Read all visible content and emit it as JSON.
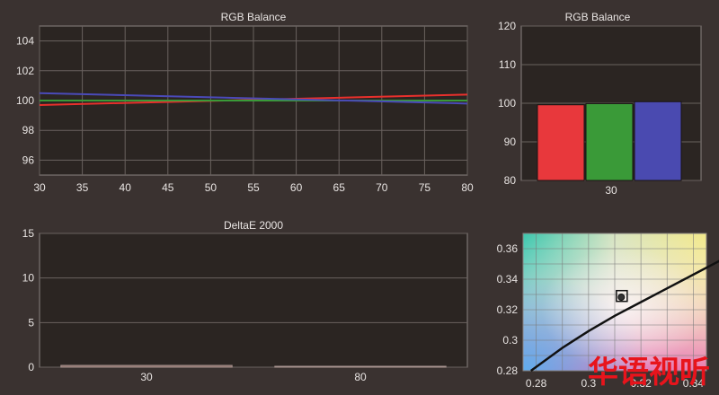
{
  "chart_data": [
    {
      "type": "line",
      "title": "RGB Balance",
      "x": [
        30,
        80
      ],
      "xticks": [
        30,
        35,
        40,
        45,
        50,
        55,
        60,
        65,
        70,
        75,
        80
      ],
      "yticks": [
        96,
        98,
        100,
        102,
        104
      ],
      "xlim": [
        30,
        80
      ],
      "ylim": [
        95,
        105
      ],
      "grid": true,
      "series": [
        {
          "color": "#e8302c",
          "values": [
            99.7,
            100.4
          ]
        },
        {
          "color": "#3a9a38",
          "values": [
            100.0,
            100.0
          ]
        },
        {
          "color": "#4a4ab8",
          "values": [
            100.5,
            99.8
          ]
        }
      ]
    },
    {
      "type": "bar",
      "title": "RGB Balance",
      "categories": [
        "30"
      ],
      "yticks": [
        80,
        90,
        100,
        110,
        120
      ],
      "ylim": [
        80,
        120
      ],
      "grid": true,
      "series": [
        {
          "color": "#e8383c",
          "values": [
            99.6
          ]
        },
        {
          "color": "#3a9a38",
          "values": [
            99.9
          ]
        },
        {
          "color": "#4a4ab0",
          "values": [
            100.4
          ]
        }
      ]
    },
    {
      "type": "bar",
      "title": "DeltaE 2000",
      "categories": [
        "30",
        "80"
      ],
      "yticks": [
        0,
        5,
        10,
        15
      ],
      "ylim": [
        0,
        15
      ],
      "grid": true,
      "values": [
        0.2,
        0.1
      ]
    },
    {
      "type": "scatter",
      "title": "",
      "xticks": [
        "0.28",
        "0.3",
        "0.32",
        "0.34"
      ],
      "yticks": [
        "0.28",
        "0.3",
        "0.32",
        "0.34",
        "0.36"
      ],
      "xlim": [
        0.275,
        0.345
      ],
      "ylim": [
        0.28,
        0.37
      ],
      "grid": true,
      "target": [
        0.3127,
        0.329
      ],
      "measured": [
        [
          0.3125,
          0.3282
        ]
      ],
      "planckian_locus": [
        [
          0.278,
          0.28
        ],
        [
          0.29,
          0.295
        ],
        [
          0.3,
          0.306
        ],
        [
          0.31,
          0.316
        ],
        [
          0.32,
          0.325
        ],
        [
          0.33,
          0.334
        ],
        [
          0.34,
          0.343
        ],
        [
          0.35,
          0.352
        ],
        [
          0.36,
          0.359
        ]
      ]
    }
  ],
  "watermark": "华语视听"
}
